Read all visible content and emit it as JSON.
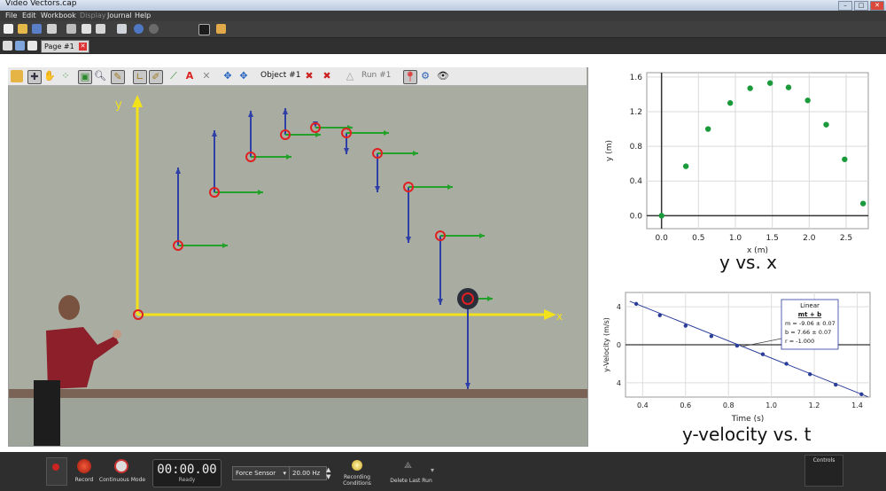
{
  "window": {
    "title": "Video Vectors.cap",
    "controls": [
      "–",
      "□",
      "✕"
    ]
  },
  "menu": [
    {
      "label": "File",
      "enabled": true
    },
    {
      "label": "Edit",
      "enabled": true
    },
    {
      "label": "Workbook",
      "enabled": true
    },
    {
      "label": "Display",
      "enabled": false
    },
    {
      "label": "Journal",
      "enabled": true
    },
    {
      "label": "Help",
      "enabled": true
    }
  ],
  "tab": {
    "label": "Page #1"
  },
  "video_toolbar": {
    "object_label": "Object #1",
    "run_label": "Run #1"
  },
  "video": {
    "axis_x_label": "x",
    "axis_y_label": "y",
    "colors": {
      "axis": "#f2e21b",
      "velocity_y": "#2f3fa8",
      "velocity_x": "#23a12a",
      "marker": "#e02020",
      "background": "#a9aca1"
    },
    "note": ""
  },
  "chart_data": [
    {
      "type": "scatter",
      "title": "y vs. x",
      "xlabel": "x (m)",
      "ylabel": "y (m)",
      "xlim": [
        -0.2,
        2.8
      ],
      "ylim": [
        -0.15,
        1.65
      ],
      "xticks": [
        "0.0",
        "0.5",
        "1.0",
        "1.5",
        "2.0",
        "2.5"
      ],
      "yticks": [
        "0.0",
        "0.4",
        "0.8",
        "1.2",
        "1.6"
      ],
      "x": [
        0.0,
        0.33,
        0.63,
        0.93,
        1.2,
        1.47,
        1.72,
        1.98,
        2.23,
        2.48,
        2.73
      ],
      "y": [
        0.0,
        0.57,
        1.0,
        1.3,
        1.47,
        1.53,
        1.48,
        1.33,
        1.05,
        0.65,
        0.14
      ],
      "grid": true,
      "color": "#1a9a3a"
    },
    {
      "type": "line",
      "title": "y-velocity vs. t",
      "xlabel": "Time (s)",
      "ylabel": "y-Velocity  (m/s)",
      "xlim": [
        0.32,
        1.46
      ],
      "ylim": [
        5.5,
        -5.5
      ],
      "xticks": [
        "0.4",
        "0.6",
        "0.8",
        "1.0",
        "1.2",
        "1.4"
      ],
      "yticks": [
        "4",
        "0",
        "4"
      ],
      "x": [
        0.37,
        0.48,
        0.6,
        0.72,
        0.84,
        0.96,
        1.07,
        1.18,
        1.3,
        1.42
      ],
      "y": [
        -4.3,
        -3.1,
        -2.0,
        -0.9,
        0.1,
        1.0,
        2.0,
        3.1,
        4.2,
        5.2
      ],
      "fit": {
        "label": "Linear",
        "formula": "mt + b",
        "m": "m  = -9.06 ± 0.07",
        "b": "b  = 7.66 ± 0.07",
        "r": "r = -1.000"
      },
      "grid": true,
      "color": "#2a3d99"
    }
  ],
  "bottom": {
    "record": "Record",
    "mode": "Continuous Mode",
    "timer": "00:00.00",
    "status": "Ready",
    "sensor": "Force Sensor",
    "rate": "20.00 Hz",
    "recording_conditions": "Recording Conditions",
    "delete_last_run": "Delete Last Run",
    "controls_label": "Controls"
  }
}
